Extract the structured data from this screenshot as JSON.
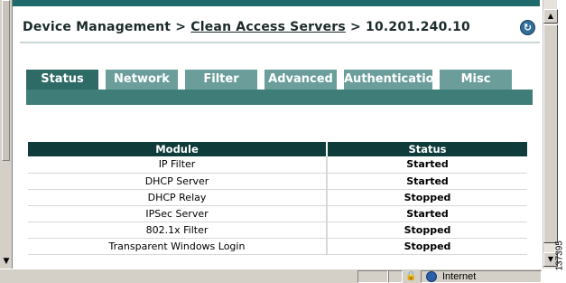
{
  "breadcrumb": {
    "part1": "Device Management > ",
    "link": "Clean Access Servers",
    "part2": " > 10.201.240.10"
  },
  "tabs": [
    {
      "label": "Status",
      "active": true
    },
    {
      "label": "Network",
      "active": false
    },
    {
      "label": "Filter",
      "active": false
    },
    {
      "label": "Advanced",
      "active": false
    },
    {
      "label": "Authentication",
      "active": false
    },
    {
      "label": "Misc",
      "active": false
    }
  ],
  "table": {
    "headers": [
      "Module",
      "Status"
    ],
    "rows": [
      {
        "module": "IP Filter",
        "status": "Started"
      },
      {
        "module": "DHCP Server",
        "status": "Started"
      },
      {
        "module": "DHCP Relay",
        "status": "Stopped"
      },
      {
        "module": "IPSec Server",
        "status": "Started"
      },
      {
        "module": "802.1x Filter",
        "status": "Stopped"
      },
      {
        "module": "Transparent Windows Login",
        "status": "Stopped"
      }
    ]
  },
  "statusbar": {
    "zone": "Internet"
  },
  "figure_number": "137395",
  "colors": {
    "accent": "#2e6a66",
    "tab_inactive": "#6b9e9b",
    "table_header": "#0f3b3b"
  },
  "icons": {
    "refresh": "refresh-icon",
    "lock": "lock-icon",
    "zone": "globe-icon"
  }
}
